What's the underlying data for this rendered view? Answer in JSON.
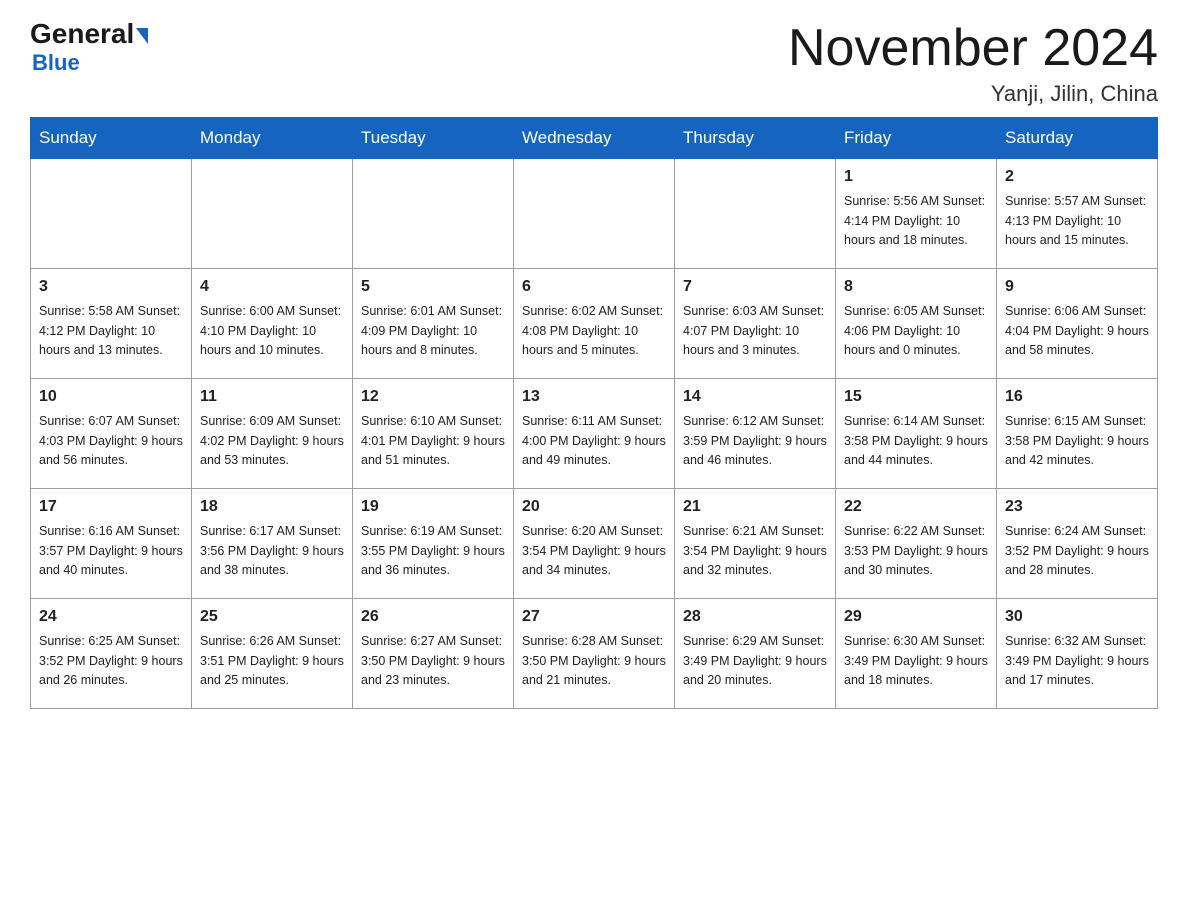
{
  "header": {
    "logo_general": "General",
    "logo_blue": "Blue",
    "month_title": "November 2024",
    "location": "Yanji, Jilin, China"
  },
  "days_of_week": [
    "Sunday",
    "Monday",
    "Tuesday",
    "Wednesday",
    "Thursday",
    "Friday",
    "Saturday"
  ],
  "weeks": [
    [
      {
        "day": "",
        "info": ""
      },
      {
        "day": "",
        "info": ""
      },
      {
        "day": "",
        "info": ""
      },
      {
        "day": "",
        "info": ""
      },
      {
        "day": "",
        "info": ""
      },
      {
        "day": "1",
        "info": "Sunrise: 5:56 AM\nSunset: 4:14 PM\nDaylight: 10 hours\nand 18 minutes."
      },
      {
        "day": "2",
        "info": "Sunrise: 5:57 AM\nSunset: 4:13 PM\nDaylight: 10 hours\nand 15 minutes."
      }
    ],
    [
      {
        "day": "3",
        "info": "Sunrise: 5:58 AM\nSunset: 4:12 PM\nDaylight: 10 hours\nand 13 minutes."
      },
      {
        "day": "4",
        "info": "Sunrise: 6:00 AM\nSunset: 4:10 PM\nDaylight: 10 hours\nand 10 minutes."
      },
      {
        "day": "5",
        "info": "Sunrise: 6:01 AM\nSunset: 4:09 PM\nDaylight: 10 hours\nand 8 minutes."
      },
      {
        "day": "6",
        "info": "Sunrise: 6:02 AM\nSunset: 4:08 PM\nDaylight: 10 hours\nand 5 minutes."
      },
      {
        "day": "7",
        "info": "Sunrise: 6:03 AM\nSunset: 4:07 PM\nDaylight: 10 hours\nand 3 minutes."
      },
      {
        "day": "8",
        "info": "Sunrise: 6:05 AM\nSunset: 4:06 PM\nDaylight: 10 hours\nand 0 minutes."
      },
      {
        "day": "9",
        "info": "Sunrise: 6:06 AM\nSunset: 4:04 PM\nDaylight: 9 hours\nand 58 minutes."
      }
    ],
    [
      {
        "day": "10",
        "info": "Sunrise: 6:07 AM\nSunset: 4:03 PM\nDaylight: 9 hours\nand 56 minutes."
      },
      {
        "day": "11",
        "info": "Sunrise: 6:09 AM\nSunset: 4:02 PM\nDaylight: 9 hours\nand 53 minutes."
      },
      {
        "day": "12",
        "info": "Sunrise: 6:10 AM\nSunset: 4:01 PM\nDaylight: 9 hours\nand 51 minutes."
      },
      {
        "day": "13",
        "info": "Sunrise: 6:11 AM\nSunset: 4:00 PM\nDaylight: 9 hours\nand 49 minutes."
      },
      {
        "day": "14",
        "info": "Sunrise: 6:12 AM\nSunset: 3:59 PM\nDaylight: 9 hours\nand 46 minutes."
      },
      {
        "day": "15",
        "info": "Sunrise: 6:14 AM\nSunset: 3:58 PM\nDaylight: 9 hours\nand 44 minutes."
      },
      {
        "day": "16",
        "info": "Sunrise: 6:15 AM\nSunset: 3:58 PM\nDaylight: 9 hours\nand 42 minutes."
      }
    ],
    [
      {
        "day": "17",
        "info": "Sunrise: 6:16 AM\nSunset: 3:57 PM\nDaylight: 9 hours\nand 40 minutes."
      },
      {
        "day": "18",
        "info": "Sunrise: 6:17 AM\nSunset: 3:56 PM\nDaylight: 9 hours\nand 38 minutes."
      },
      {
        "day": "19",
        "info": "Sunrise: 6:19 AM\nSunset: 3:55 PM\nDaylight: 9 hours\nand 36 minutes."
      },
      {
        "day": "20",
        "info": "Sunrise: 6:20 AM\nSunset: 3:54 PM\nDaylight: 9 hours\nand 34 minutes."
      },
      {
        "day": "21",
        "info": "Sunrise: 6:21 AM\nSunset: 3:54 PM\nDaylight: 9 hours\nand 32 minutes."
      },
      {
        "day": "22",
        "info": "Sunrise: 6:22 AM\nSunset: 3:53 PM\nDaylight: 9 hours\nand 30 minutes."
      },
      {
        "day": "23",
        "info": "Sunrise: 6:24 AM\nSunset: 3:52 PM\nDaylight: 9 hours\nand 28 minutes."
      }
    ],
    [
      {
        "day": "24",
        "info": "Sunrise: 6:25 AM\nSunset: 3:52 PM\nDaylight: 9 hours\nand 26 minutes."
      },
      {
        "day": "25",
        "info": "Sunrise: 6:26 AM\nSunset: 3:51 PM\nDaylight: 9 hours\nand 25 minutes."
      },
      {
        "day": "26",
        "info": "Sunrise: 6:27 AM\nSunset: 3:50 PM\nDaylight: 9 hours\nand 23 minutes."
      },
      {
        "day": "27",
        "info": "Sunrise: 6:28 AM\nSunset: 3:50 PM\nDaylight: 9 hours\nand 21 minutes."
      },
      {
        "day": "28",
        "info": "Sunrise: 6:29 AM\nSunset: 3:49 PM\nDaylight: 9 hours\nand 20 minutes."
      },
      {
        "day": "29",
        "info": "Sunrise: 6:30 AM\nSunset: 3:49 PM\nDaylight: 9 hours\nand 18 minutes."
      },
      {
        "day": "30",
        "info": "Sunrise: 6:32 AM\nSunset: 3:49 PM\nDaylight: 9 hours\nand 17 minutes."
      }
    ]
  ]
}
